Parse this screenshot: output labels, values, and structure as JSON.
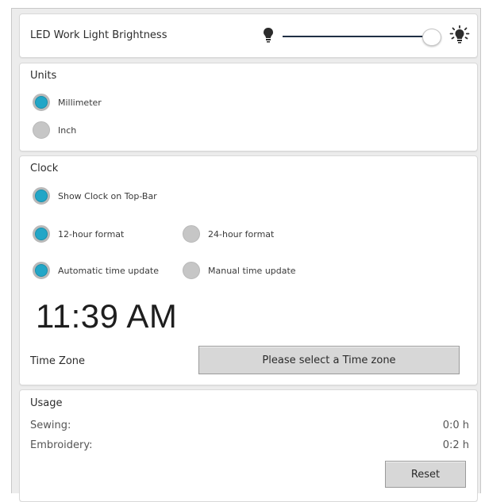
{
  "brightness": {
    "label": "LED Work Light Brightness",
    "level_fraction": 1.0,
    "low_icon": "bulb-off-icon",
    "high_icon": "bulb-bright-icon"
  },
  "units": {
    "title": "Units",
    "options": [
      {
        "label": "Millimeter",
        "selected": true
      },
      {
        "label": "Inch",
        "selected": false
      }
    ]
  },
  "clock": {
    "title": "Clock",
    "show_clock_label": "Show Clock on Top-Bar",
    "show_clock_selected": true,
    "format_12_label": "12-hour format",
    "format_12_selected": true,
    "format_24_label": "24-hour format",
    "format_24_selected": false,
    "auto_update_label": "Automatic time update",
    "auto_update_selected": true,
    "manual_update_label": "Manual time update",
    "manual_update_selected": false,
    "time": "11:39 AM",
    "timezone_label": "Time Zone",
    "timezone_button": "Please select a Time zone"
  },
  "usage": {
    "title": "Usage",
    "rows": [
      {
        "label": "Sewing:",
        "value": "0:0 h"
      },
      {
        "label": "Embroidery:",
        "value": "0:2 h"
      }
    ],
    "reset_label": "Reset"
  },
  "colors": {
    "accent": "#22a6c7",
    "radio_off": "#c6c6c6",
    "panel_bg": "#ececec"
  }
}
